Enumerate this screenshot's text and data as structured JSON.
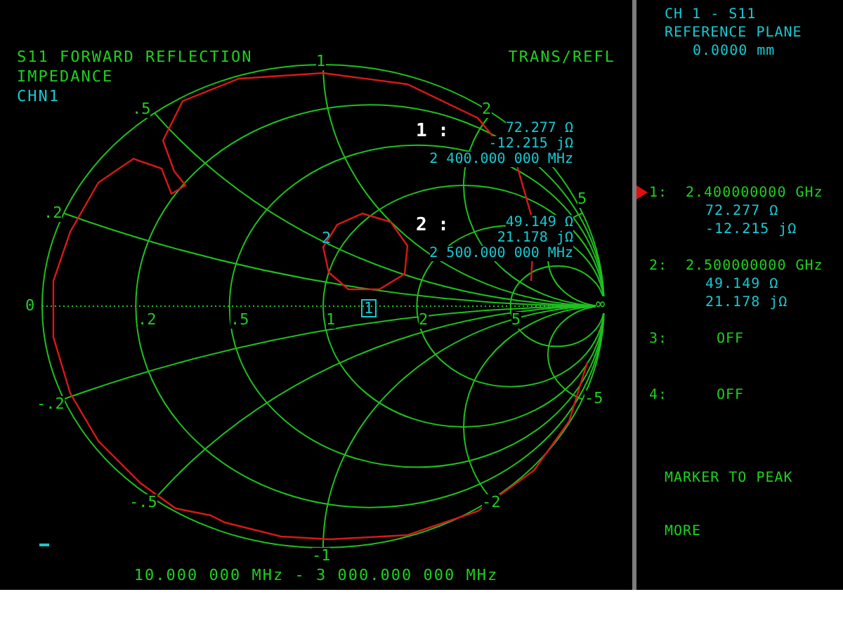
{
  "header": {
    "title": "S11 FORWARD REFLECTION",
    "format": "IMPEDANCE",
    "channel": "CHN1",
    "mode": "TRANS/REFL"
  },
  "smith_chart": {
    "axis_labels": [
      "1",
      ".5",
      "2",
      ".2",
      "5",
      "0",
      ".2",
      ".5",
      "1",
      "2",
      "5",
      "∞",
      "-.2",
      "-5",
      "-.5",
      "-2",
      "-1"
    ],
    "markers": [
      {
        "label": "1"
      },
      {
        "label": "2"
      }
    ],
    "readouts": [
      {
        "index": "1 :",
        "resistance": "72.277 Ω",
        "reactance": "-12.215 jΩ",
        "frequency": "2 400.000 000 MHz"
      },
      {
        "index": "2 :",
        "resistance": "49.149 Ω",
        "reactance": "21.178 jΩ",
        "frequency": "2 500.000 000 MHz"
      }
    ]
  },
  "sweep_range": "10.000 000 MHz - 3 000.000 000 MHz",
  "panel": {
    "title": "CH 1 - S11",
    "subtitle": "REFERENCE PLANE",
    "offset": "0.0000 mm",
    "markers": [
      {
        "label": "1:",
        "selected": true,
        "frequency": "2.400000000 GHz",
        "resistance": "72.277 Ω",
        "reactance": "-12.215 jΩ"
      },
      {
        "label": "2:",
        "selected": false,
        "frequency": "2.500000000 GHz",
        "resistance": "49.149 Ω",
        "reactance": "21.178 jΩ"
      },
      {
        "label": "3:",
        "selected": false,
        "status": "OFF"
      },
      {
        "label": "4:",
        "selected": false,
        "status": "OFF"
      }
    ],
    "softkeys": [
      "MARKER TO PEAK",
      "MORE"
    ]
  }
}
